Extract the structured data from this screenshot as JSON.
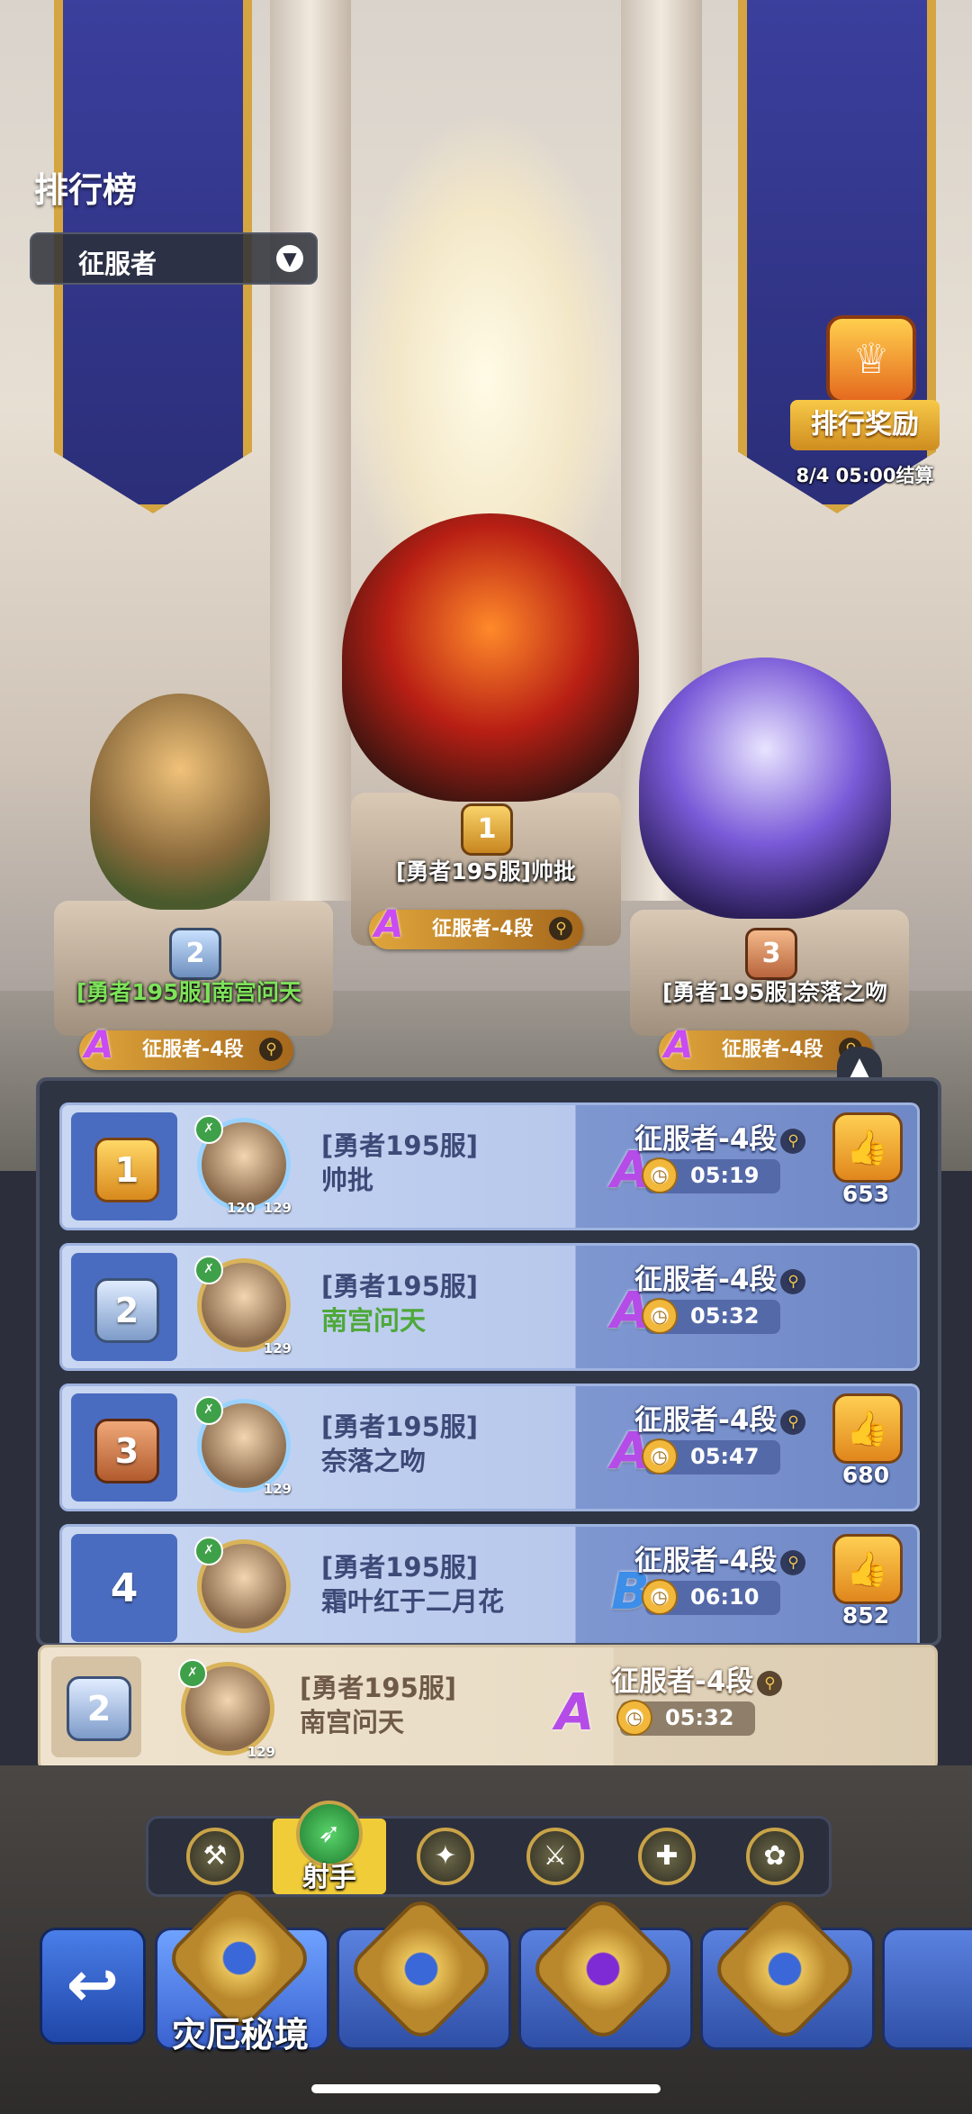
{
  "header": {
    "title": "排行榜",
    "dropdown_value": "征服者",
    "reward_label": "排行奖励",
    "reward_settle": "8/4 05:00结算"
  },
  "podium": [
    {
      "rank": "1",
      "name": "[勇者195服]帅批",
      "tier": "征服者-4段",
      "grade": "A"
    },
    {
      "rank": "2",
      "name": "[勇者195服]南宫问天",
      "tier": "征服者-4段",
      "grade": "A"
    },
    {
      "rank": "3",
      "name": "[勇者195服]奈落之吻",
      "tier": "征服者-4段",
      "grade": "A"
    }
  ],
  "list": [
    {
      "rank": "1",
      "server": "[勇者195服]",
      "name": "帅批",
      "grade": "A",
      "tier": "征服者-4段",
      "time": "05:19",
      "likes": "653",
      "levels": [
        "120",
        "129"
      ]
    },
    {
      "rank": "2",
      "server": "[勇者195服]",
      "name": "南宫问天",
      "grade": "A",
      "tier": "征服者-4段",
      "time": "05:32",
      "likes": "",
      "levels": [
        "129"
      ]
    },
    {
      "rank": "3",
      "server": "[勇者195服]",
      "name": "奈落之吻",
      "grade": "A",
      "tier": "征服者-4段",
      "time": "05:47",
      "likes": "680",
      "levels": [
        "129"
      ]
    },
    {
      "rank": "4",
      "server": "[勇者195服]",
      "name": "霜叶红于二月花",
      "grade": "B",
      "tier": "征服者-4段",
      "time": "06:10",
      "likes": "852",
      "levels": []
    }
  ],
  "my_row": {
    "rank": "2",
    "server": "[勇者195服]",
    "name": "南宫问天",
    "grade": "A",
    "tier": "征服者-4段",
    "time": "05:32",
    "level": "129"
  },
  "class_tabs": {
    "selected_label": "射手",
    "icons": [
      "warrior-icon",
      "archer-icon",
      "mage-icon",
      "assassin-icon",
      "support-icon",
      "summoner-icon"
    ]
  },
  "nav": {
    "active_label": "灾厄秘境"
  },
  "colors": {
    "accent_gold": "#f0cc38",
    "grade_a": "#b54ce8",
    "grade_b": "#3d8ee8",
    "panel": "#2f3443"
  }
}
